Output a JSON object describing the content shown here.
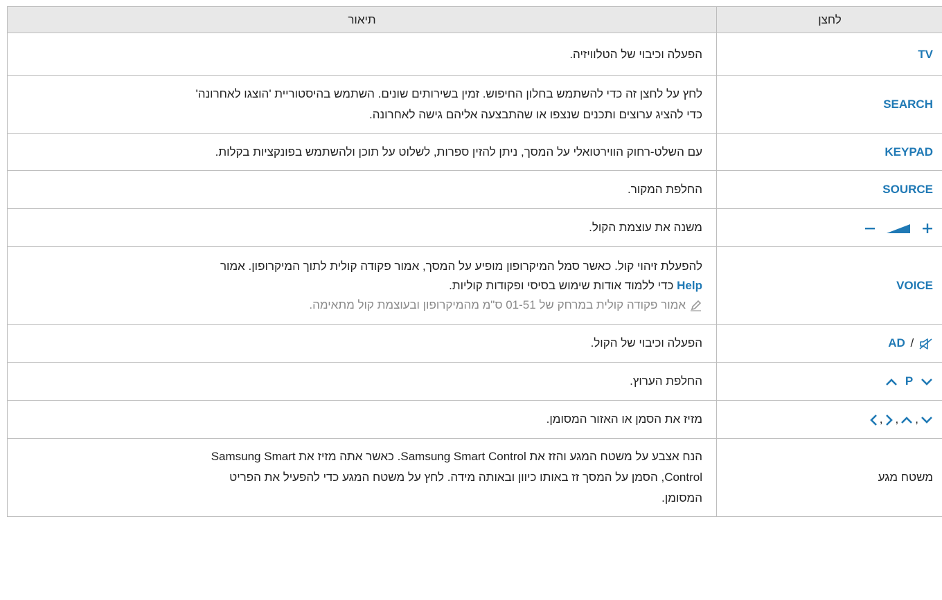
{
  "header": {
    "col_button": "לחצן",
    "col_description": "תיאור"
  },
  "rows": {
    "tv": {
      "button": "TV",
      "desc": "הפעלה וכיבוי של הטלוויזיה."
    },
    "search": {
      "button": "SEARCH",
      "line1": "לחץ על לחצן זה כדי להשתמש בחלון החיפוש. זמין בשירותים שונים. השתמש בהיסטוריית 'הוצגו לאחרונה'",
      "line2": "כדי להציג ערוצים ותכנים שנצפו או שהתבצעה אליהם גישה לאחרונה."
    },
    "keypad": {
      "button": "KEYPAD",
      "desc": "עם השלט-רחוק הווירטואלי על המסך, ניתן להזין ספרות, לשלוט על תוכן ולהשתמש בפונקציות בקלות."
    },
    "source": {
      "button": "SOURCE",
      "desc": "החלפת המקור."
    },
    "volume": {
      "button_icons": [
        "minus-icon",
        "volume-ramp-icon",
        "plus-icon"
      ],
      "desc": "משנה את עוצמת הקול."
    },
    "voice": {
      "button": "VOICE",
      "line1": "להפעלת זיהוי קול. כאשר סמל המיקרופון מופיע על המסך, אמור פקודה קולית לתוך המיקרופון. אמור",
      "help": "Help",
      "line2": " כדי ללמוד אודות שימוש בסיסי ופקודות קוליות.",
      "note": "אמור פקודה קולית במרחק של 01-51 ס\"מ מהמיקרופון ובעוצמת קול מתאימה."
    },
    "ad": {
      "button": "AD",
      "sep": "/",
      "desc": "הפעלה וכיבוי של הקול."
    },
    "channel": {
      "button": "P",
      "desc": "החלפת הערוץ."
    },
    "arrows": {
      "comma": ",",
      "desc": "מזיז את הסמן או האזור המסומן."
    },
    "touchpad": {
      "button": "משטח מגע",
      "line1": "הנח אצבע על משטח המגע והזז את Samsung Smart Control. כאשר אתה מזיז את Samsung Smart",
      "line2": "Control, הסמן על המסך זז באותו כיוון ובאותה מידה. לחץ על משטח המגע כדי להפעיל את הפריט",
      "line3": "המסומן."
    }
  },
  "colors": {
    "accent": "#1f79b5",
    "header_bg": "#e8e8e8",
    "border": "#bdbdbd",
    "note": "#8a8a8a"
  }
}
